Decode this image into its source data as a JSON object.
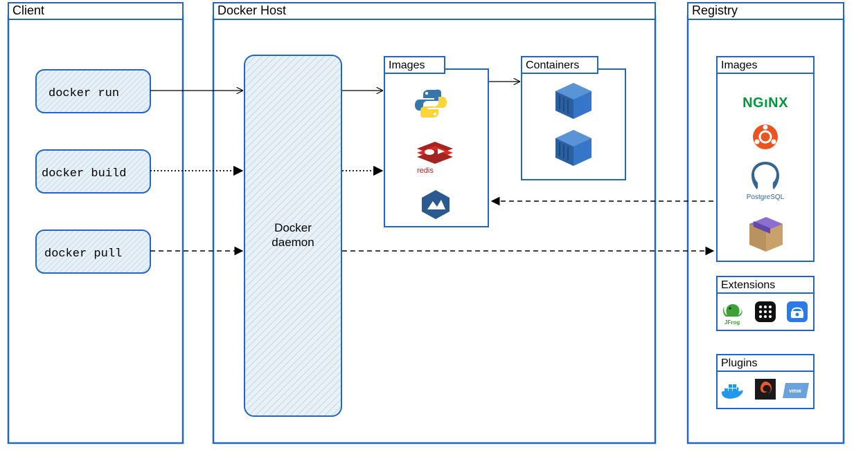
{
  "colors": {
    "stroke": "#2066c6",
    "cmd_fill": "#e6f0f7",
    "daemon_fill": "#e9f1f8",
    "nginx_green": "#009639",
    "ubuntu_orange": "#e95420",
    "pg_blue": "#336791",
    "docker_blue": "#2396ed",
    "grafana": "#f05a28",
    "vmware": "#6aa2dc",
    "jfrog": "#3fa037",
    "redis_red": "#a32422",
    "container_blue": "#3576c8",
    "alpine": "#2a5a8f"
  },
  "client": {
    "title": "Client",
    "commands": [
      {
        "id": "docker-run",
        "label": "docker run"
      },
      {
        "id": "docker-build",
        "label": "docker build"
      },
      {
        "id": "docker-pull",
        "label": "docker pull"
      }
    ]
  },
  "host": {
    "title": "Docker Host",
    "daemon_label": "Docker\ndaemon",
    "images_title": "Images",
    "images": [
      {
        "id": "python-image",
        "name": "python"
      },
      {
        "id": "redis-image",
        "name": "redis"
      },
      {
        "id": "alpine-image",
        "name": "alpine"
      }
    ],
    "containers_title": "Containers",
    "containers": [
      {
        "id": "container-1"
      },
      {
        "id": "container-2"
      }
    ]
  },
  "registry": {
    "title": "Registry",
    "images_title": "Images",
    "images": [
      {
        "id": "nginx",
        "label": "NGINX"
      },
      {
        "id": "ubuntu",
        "label": "ubuntu"
      },
      {
        "id": "postgresql",
        "label": "PostgreSQL"
      },
      {
        "id": "package",
        "label": "package"
      }
    ],
    "extensions_title": "Extensions",
    "extensions": [
      {
        "id": "jfrog"
      },
      {
        "id": "app-grid"
      },
      {
        "id": "portainer"
      }
    ],
    "plugins_title": "Plugins",
    "plugins": [
      {
        "id": "docker-sbom"
      },
      {
        "id": "grafana"
      },
      {
        "id": "vmware"
      }
    ]
  },
  "arrows": [
    {
      "from": "docker-run",
      "to": "docker-daemon",
      "style": "solid"
    },
    {
      "from": "docker-build",
      "to": "docker-daemon",
      "style": "dotted"
    },
    {
      "from": "docker-pull",
      "to": "docker-daemon",
      "style": "dashed"
    },
    {
      "from": "docker-daemon",
      "to": "host-images",
      "style": "solid",
      "via": "run"
    },
    {
      "from": "docker-daemon",
      "to": "host-images",
      "style": "dotted",
      "via": "build"
    },
    {
      "from": "docker-daemon",
      "to": "registry",
      "style": "dashed",
      "via": "pull"
    },
    {
      "from": "host-images",
      "to": "containers",
      "style": "solid"
    },
    {
      "from": "registry-images",
      "to": "host-images",
      "style": "dashed"
    }
  ]
}
